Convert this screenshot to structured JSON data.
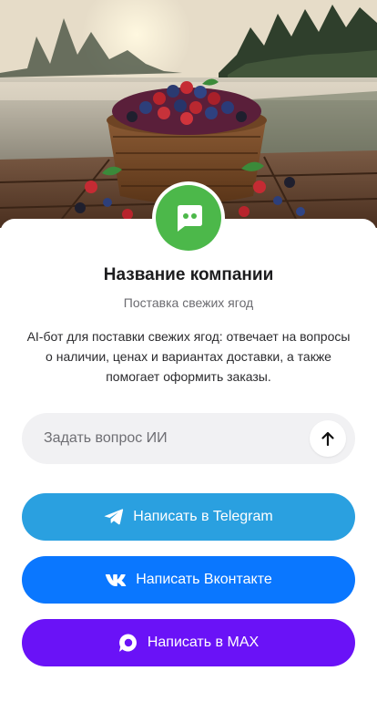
{
  "hero": {
    "image": "berries-basket-lake-photo"
  },
  "company": {
    "avatar_icon": "chat-bot-icon",
    "avatar_color": "#4cb84a",
    "name": "Название компании",
    "tagline": "Поставка свежих ягод",
    "description": "AI-бот для поставки свежих ягод: отвечает на вопросы о наличии, ценах и вариантах доставки, а также помогает оформить заказы."
  },
  "ask": {
    "placeholder": "Задать вопрос ИИ",
    "send_icon": "arrow-up-icon"
  },
  "buttons": {
    "telegram": {
      "label": "Написать в Telegram",
      "icon": "telegram-icon",
      "color": "#2aa0e0"
    },
    "vk": {
      "label": "Написать Вконтакте",
      "icon": "vk-icon",
      "color": "#0a77ff"
    },
    "max": {
      "label": "Написать в MAX",
      "icon": "max-icon",
      "color": "#6a12f7"
    }
  }
}
